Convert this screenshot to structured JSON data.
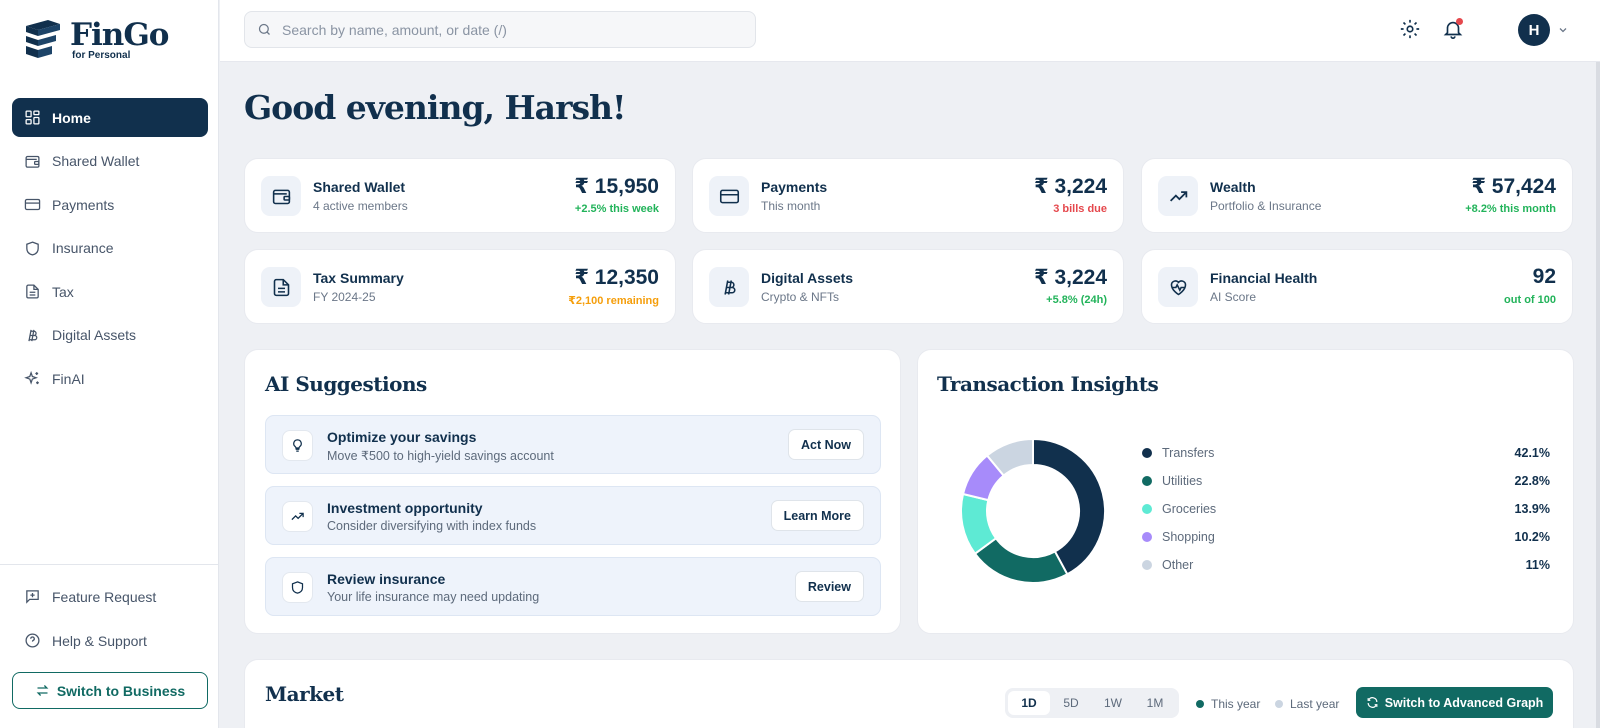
{
  "brand": {
    "name": "FinGo",
    "sub": "for Personal"
  },
  "sidebar": {
    "items": [
      {
        "label": "Home",
        "icon": "grid-icon",
        "active": true
      },
      {
        "label": "Shared Wallet",
        "icon": "wallet-icon"
      },
      {
        "label": "Payments",
        "icon": "credit-card-icon"
      },
      {
        "label": "Insurance",
        "icon": "shield-icon"
      },
      {
        "label": "Tax",
        "icon": "document-icon"
      },
      {
        "label": "Digital Assets",
        "icon": "bitcoin-icon"
      },
      {
        "label": "FinAI",
        "icon": "sparkles-icon"
      }
    ],
    "bottom_items": [
      {
        "label": "Feature Request",
        "icon": "message-plus-icon"
      },
      {
        "label": "Help & Support",
        "icon": "help-circle-icon"
      }
    ],
    "switch_label": "Switch to Business"
  },
  "header": {
    "search_placeholder": "Search by name, amount, or date (/)",
    "avatar_initial": "H",
    "notification_dot_color": "#e5484d"
  },
  "greeting": "Good evening, Harsh!",
  "stats": [
    {
      "title": "Shared Wallet",
      "subtitle": "4 active members",
      "value": "₹ 15,950",
      "note": "+2.5% this week",
      "note_color": "green",
      "icon": "wallet-icon"
    },
    {
      "title": "Payments",
      "subtitle": "This month",
      "value": "₹ 3,224",
      "note": "3 bills due",
      "note_color": "red",
      "icon": "credit-card-icon"
    },
    {
      "title": "Wealth",
      "subtitle": "Portfolio & Insurance",
      "value": "₹ 57,424",
      "note": "+8.2% this month",
      "note_color": "green",
      "icon": "trending-up-icon"
    },
    {
      "title": "Tax Summary",
      "subtitle": "FY 2024-25",
      "value": "₹ 12,350",
      "note": "₹2,100 remaining",
      "note_color": "orange",
      "icon": "document-icon"
    },
    {
      "title": "Digital Assets",
      "subtitle": "Crypto & NFTs",
      "value": "₹ 3,224",
      "note": "+5.8% (24h)",
      "note_color": "green",
      "icon": "bitcoin-icon"
    },
    {
      "title": "Financial Health",
      "subtitle": "AI Score",
      "value": "92",
      "note": "out of 100",
      "note_color": "green",
      "icon": "heart-pulse-icon"
    }
  ],
  "suggestions": {
    "title": "AI Suggestions",
    "items": [
      {
        "title": "Optimize your savings",
        "desc": "Move ₹500 to high-yield savings account",
        "button": "Act Now",
        "icon": "lightbulb-icon"
      },
      {
        "title": "Investment opportunity",
        "desc": "Consider diversifying with index funds",
        "button": "Learn More",
        "icon": "trending-up-icon"
      },
      {
        "title": "Review insurance",
        "desc": "Your life insurance may need updating",
        "button": "Review",
        "icon": "shield-icon"
      }
    ]
  },
  "insights": {
    "title": "Transaction Insights",
    "chart_data": {
      "type": "pie",
      "categories": [
        "Transfers",
        "Utilities",
        "Groceries",
        "Shopping",
        "Other"
      ],
      "values": [
        42.1,
        22.8,
        13.9,
        10.2,
        11
      ],
      "labels": [
        "42.1%",
        "22.8%",
        "13.9%",
        "10.2%",
        "11%"
      ],
      "colors": [
        "#11304d",
        "#116a63",
        "#5eead4",
        "#a78bfa",
        "#cbd5e1"
      ],
      "donut": true,
      "legend": "right"
    }
  },
  "market": {
    "title": "Market",
    "ranges": [
      "1D",
      "5D",
      "1W",
      "1M"
    ],
    "selected_range": "1D",
    "legend": [
      {
        "label": "This year",
        "color": "#116a63"
      },
      {
        "label": "Last year",
        "color": "#cbd5e1"
      }
    ],
    "advanced_button": "Switch to Advanced Graph"
  }
}
